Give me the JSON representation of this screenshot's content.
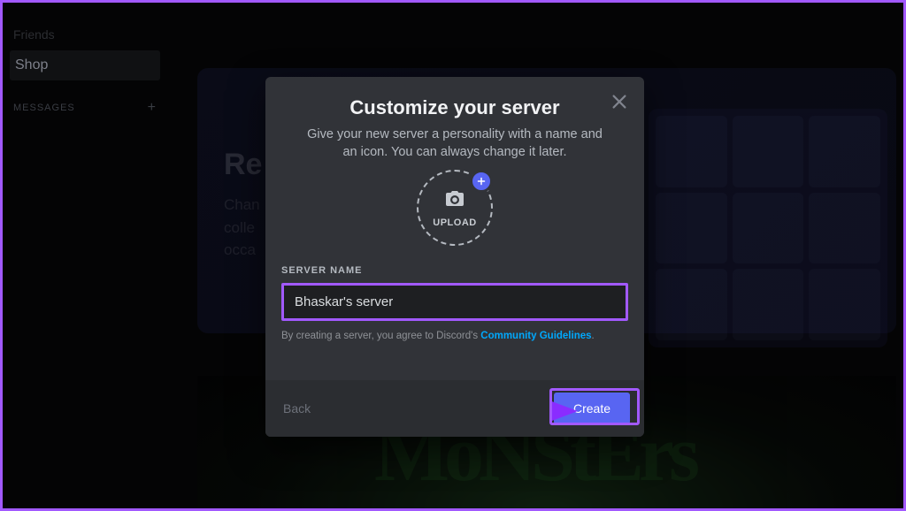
{
  "sidebar": {
    "friends": "Friends",
    "shop": "Shop",
    "messages_header": "MESSAGES"
  },
  "bg": {
    "title_fragment": "Re",
    "sub_fragment": "Chan\ncolle\nocca"
  },
  "modal": {
    "title": "Customize your server",
    "subtitle": "Give your new server a personality with a name and an icon. You can always change it later.",
    "upload_label": "UPLOAD",
    "server_name_label": "SERVER NAME",
    "server_name_value": "Bhaskar's server",
    "disclaimer_prefix": "By creating a server, you agree to Discord's ",
    "disclaimer_link": "Community Guidelines",
    "disclaimer_suffix": ".",
    "back": "Back",
    "create": "Create"
  },
  "colors": {
    "accent": "#5865f2",
    "highlight": "#a259ff",
    "link": "#00a8fc"
  }
}
